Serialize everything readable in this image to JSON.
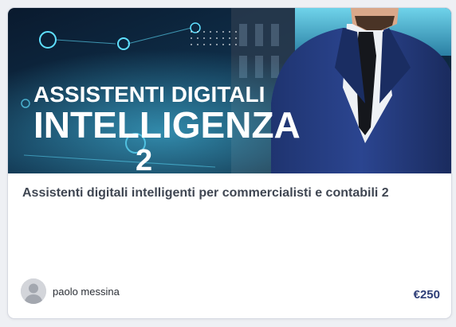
{
  "course": {
    "banner": {
      "headline_1": "ASSISTENTI DIGITALI",
      "headline_2": "INTELLIGENZA",
      "headline_3": "2"
    },
    "title": "Assistenti digitali intelligenti per commercialisti e contabili 2",
    "author": {
      "name": "paolo messina",
      "avatar": "user-avatar-icon"
    },
    "price": "€250"
  },
  "colors": {
    "price": "#2f3f78",
    "title": "#3f4652",
    "banner_glow": "#39c6ff",
    "suit": "#253b7a"
  }
}
